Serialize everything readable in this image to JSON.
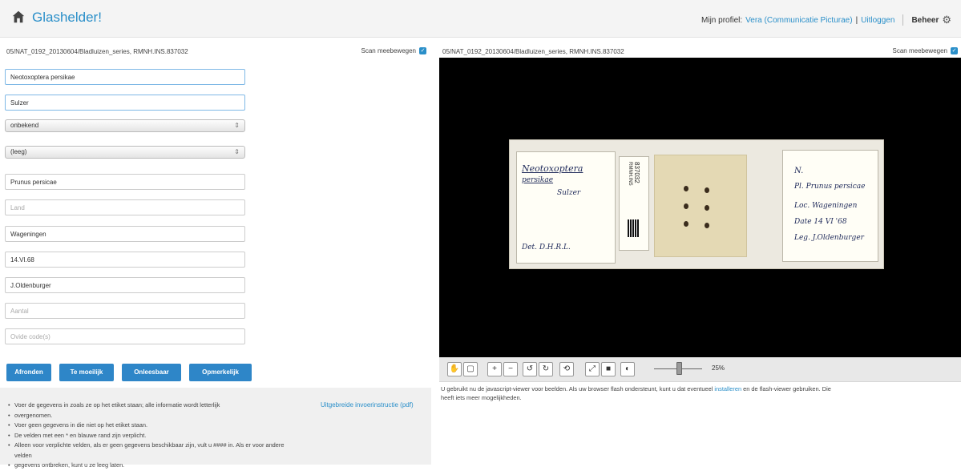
{
  "header": {
    "title": "Glashelder!",
    "profile_label": "Mijn profiel:",
    "profile_name": "Vera (Communicatie Picturae)",
    "logout": "Uitloggen",
    "admin": "Beheer",
    "brand_color": "#2a8fc9"
  },
  "left_panel": {
    "path": "05/NAT_0192_20130604/Bladluizen_series, RMNH.INS.837032",
    "sync_label": "Scan meebewegen"
  },
  "right_panel": {
    "path": "05/NAT_0192_20130604/Bladluizen_series, RMNH.INS.837032",
    "sync_label": "Scan meebewegen"
  },
  "form": {
    "name": "Neotoxoptera persikae",
    "author": "Sulzer",
    "select1": "onbekend",
    "select2": "(leeg)",
    "plant": "Prunus persicae",
    "land_placeholder": "Land",
    "place": "Wageningen",
    "date": "14.VI.68",
    "collector": "J.Oldenburger",
    "count_placeholder": "Aantal",
    "other_codes_placeholder": "Ovide code(s)"
  },
  "buttons": {
    "finish": "Afronden",
    "difficult": "Te moeilijk",
    "illegible": "Onleesbaar",
    "remark": "Opmerkelijk"
  },
  "instructions": {
    "items": [
      "Voer de gegevens in zoals ze op het etiket staan; alle informatie wordt letterlijk",
      "overgenomen.",
      "Voer geen gegevens in die niet op het etiket staan.",
      "De velden met een * en blauwe rand zijn verplicht.",
      "Alleen voor verplichte velden, als er geen gegevens beschikbaar zijn, vult u #### in. Als er voor andere velden",
      "gegevens ontbreken, kunt u ze leeg laten."
    ],
    "link": "Uitgebreide invoerinstructie (pdf)"
  },
  "slide": {
    "left_label": [
      "Neotoxoptera",
      "persikae",
      "Sulzer",
      "Det. D.H.R.L."
    ],
    "mid_label": "837032",
    "mid_label2": "RMNH.INS",
    "right_label": [
      "N.",
      "Pl. Prunus persicae",
      "Loc. Wageningen",
      "Date 14 VI '68",
      "Leg. J.Oldenburger"
    ]
  },
  "viewer": {
    "zoom": "25%",
    "zoom_fraction": 0.25,
    "tools": [
      "hand-icon",
      "select-icon",
      "zoom-in-icon",
      "zoom-out-icon",
      "rotate-left-icon",
      "rotate-right-icon",
      "reset-icon",
      "fit-icon",
      "fullscreen-icon",
      "contrast-icon"
    ],
    "note_1": "U gebruikt nu de javascript-viewer voor beelden. Als uw browser flash ondersteunt, kunt u dat eventueel",
    "note_link": "installeren",
    "note_2": "en de flash-viewer gebruiken. Die",
    "note_3": "heeft iets meer mogelijkheden."
  }
}
